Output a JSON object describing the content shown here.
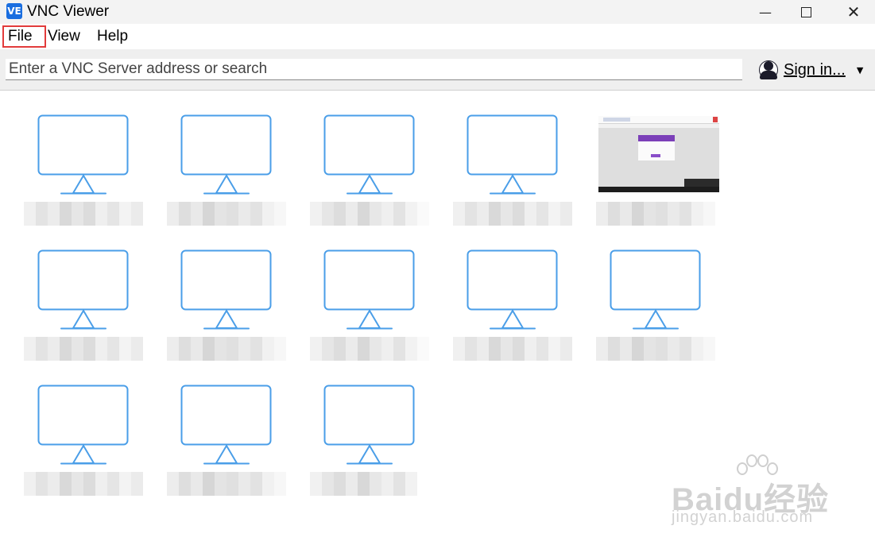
{
  "window": {
    "app_icon": "VE",
    "title": "VNC Viewer",
    "controls": {
      "minimize": "—",
      "close": "✕"
    }
  },
  "menu": {
    "file": "File",
    "view": "View",
    "help": "Help"
  },
  "toolbar": {
    "search_placeholder": "Enter a VNC Server address or search",
    "search_value": "",
    "signin_label": "Sign in...",
    "signin_caret": "▼",
    "user_icon": "user-icon"
  },
  "colors": {
    "monitor_stroke": "#4a9ee8",
    "menu_highlight": "#e23b3b"
  },
  "computers": [
    {
      "label_hidden": true,
      "has_preview": false
    },
    {
      "label_hidden": true,
      "has_preview": false
    },
    {
      "label_hidden": true,
      "has_preview": false
    },
    {
      "label_hidden": true,
      "has_preview": false
    },
    {
      "label_hidden": true,
      "has_preview": true
    },
    {
      "label_hidden": true,
      "has_preview": false
    },
    {
      "label_hidden": true,
      "has_preview": false
    },
    {
      "label_hidden": true,
      "has_preview": false
    },
    {
      "label_hidden": true,
      "has_preview": false
    },
    {
      "label_hidden": true,
      "has_preview": false
    },
    {
      "label_hidden": true,
      "has_preview": false
    },
    {
      "label_hidden": true,
      "has_preview": false
    },
    {
      "label_hidden": true,
      "has_preview": false
    }
  ],
  "watermark": {
    "brand": "Baidu经验",
    "url": "jingyan.baidu.com"
  }
}
